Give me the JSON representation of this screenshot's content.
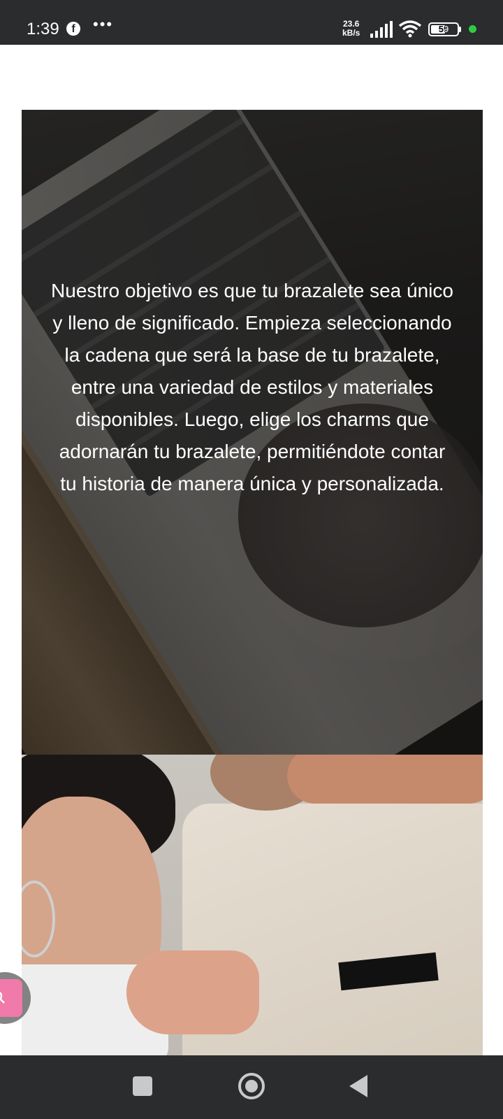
{
  "status_bar": {
    "time": "1:39",
    "net_speed_value": "23.6",
    "net_speed_unit": "kB/s",
    "battery": "59",
    "battery_level": 0.59,
    "icons": [
      "facebook-icon",
      "more-dots-icon",
      "signal-icon",
      "wifi-icon",
      "battery-icon",
      "green-dot"
    ]
  },
  "hero": {
    "text": "Nuestro objetivo es que tu brazalete sea único y lleno de significado. Empieza seleccionando la cadena que será la base de tu brazalete, entre una variedad de estilos y materiales disponibles. Luego, elige los charms que adornarán tu brazalete, permitiéndote contar tu historia de manera única y personalizada."
  },
  "floating_button": {
    "icon": "search-icon",
    "accent": "#f07aa9"
  },
  "nav_bar": {
    "icons": [
      "recents-square-icon",
      "home-circle-icon",
      "back-triangle-icon"
    ]
  },
  "colors": {
    "system_bar": "#2b2c2e",
    "page_bg": "#ffffff",
    "hero_text": "#ffffff"
  }
}
